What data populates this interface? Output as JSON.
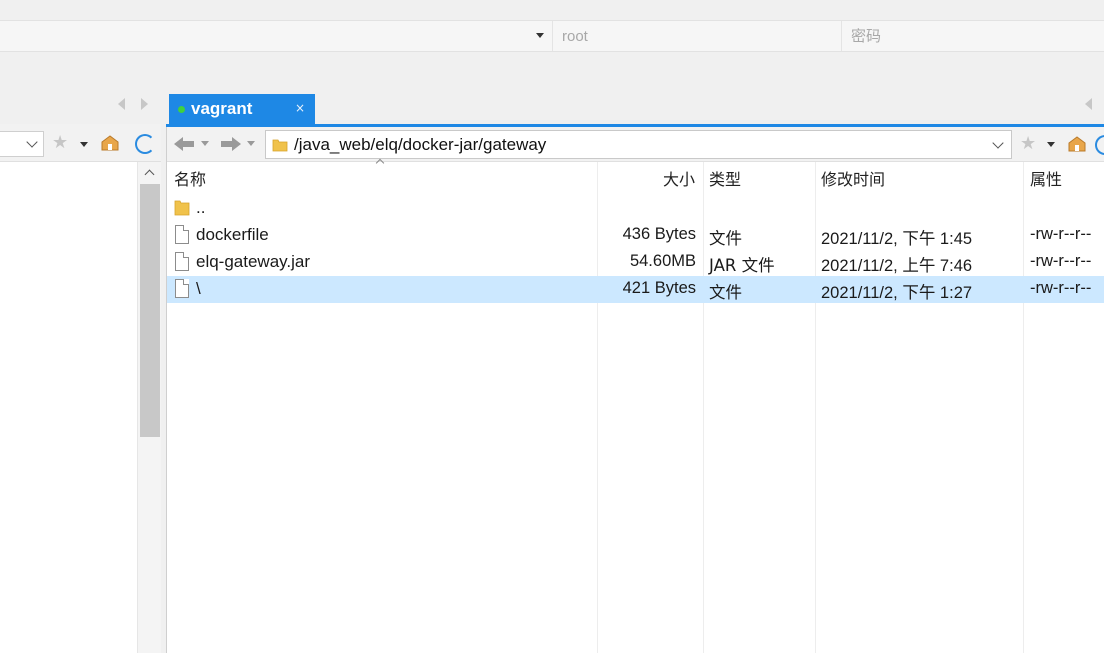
{
  "connection": {
    "user_placeholder": "root",
    "password_placeholder": "密码"
  },
  "session_tab": {
    "label": "vagrant",
    "close_glyph": "×",
    "status_color": "#3fd13f"
  },
  "remote": {
    "path": "/java_web/elq/docker-jar/gateway"
  },
  "columns": {
    "name": "名称",
    "size": "大小",
    "type": "类型",
    "modified": "修改时间",
    "permissions": "属性"
  },
  "files": [
    {
      "name": "..",
      "size": "",
      "type": "",
      "modified": "",
      "permissions": "",
      "icon": "folder-icon"
    },
    {
      "name": "dockerfile",
      "size": "436 Bytes",
      "type": "文件",
      "modified": "2021/11/2, 下午 1:45",
      "permissions": "-rw-r--r--",
      "icon": "file-icon"
    },
    {
      "name": "elq-gateway.jar",
      "size": "54.60MB",
      "type": "JAR 文件",
      "modified": "2021/11/2, 上午 7:46",
      "permissions": "-rw-r--r--",
      "icon": "file-icon"
    },
    {
      "name": "\\",
      "size": "421 Bytes",
      "type": "文件",
      "modified": "2021/11/2, 下午 1:27",
      "permissions": "-rw-r--r--",
      "icon": "file-icon",
      "selected": true
    }
  ],
  "colors": {
    "accent": "#1e88e5",
    "selection": "#cce8ff",
    "annotation": "#e02020"
  }
}
